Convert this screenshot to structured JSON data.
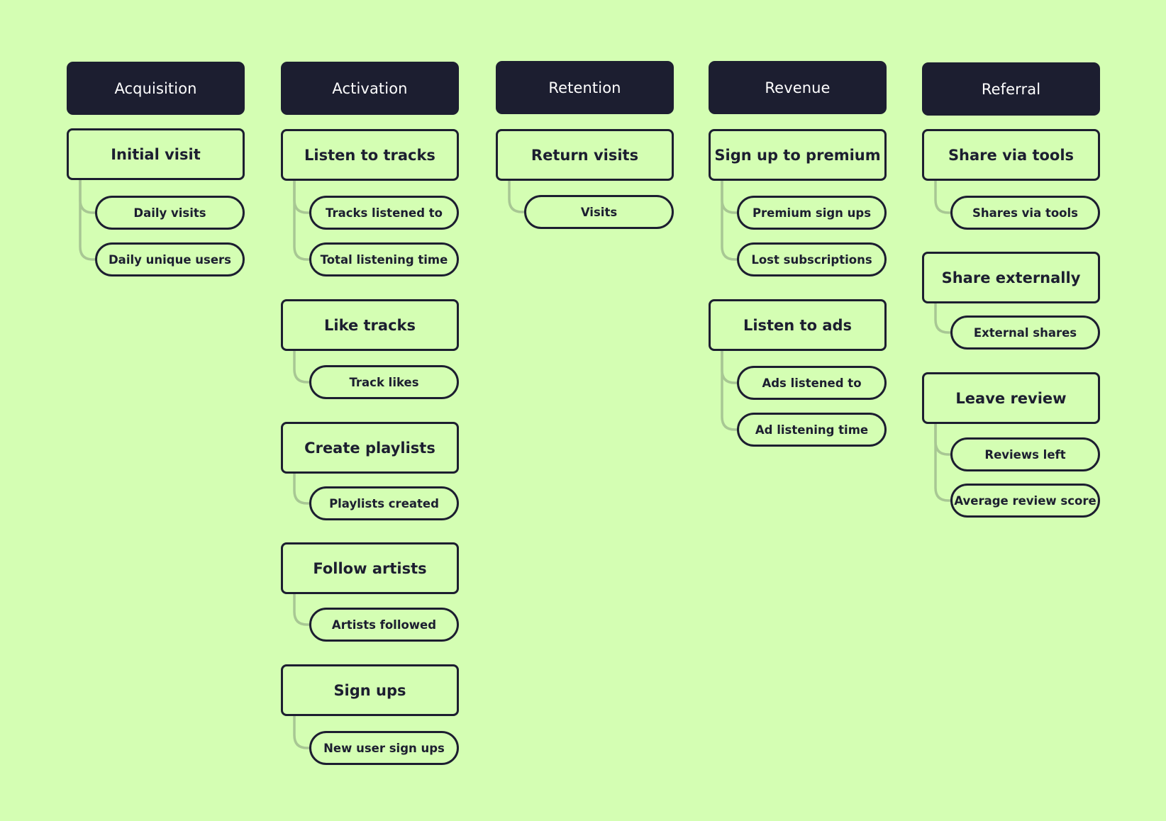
{
  "diagram": {
    "title": "",
    "stages": [
      {
        "name": "Acquisition",
        "groups": [
          {
            "activity": "Initial visit",
            "metrics": [
              "Daily visits",
              "Daily unique users"
            ]
          }
        ]
      },
      {
        "name": "Activation",
        "groups": [
          {
            "activity": "Listen to tracks",
            "metrics": [
              "Tracks listened to",
              "Total listening time"
            ]
          },
          {
            "activity": "Like tracks",
            "metrics": [
              "Track likes"
            ]
          },
          {
            "activity": "Create playlists",
            "metrics": [
              "Playlists created"
            ]
          },
          {
            "activity": "Follow artists",
            "metrics": [
              "Artists followed"
            ]
          },
          {
            "activity": "Sign ups",
            "metrics": [
              "New user sign ups"
            ]
          }
        ]
      },
      {
        "name": "Retention",
        "groups": [
          {
            "activity": "Return visits",
            "metrics": [
              "Visits"
            ]
          }
        ]
      },
      {
        "name": "Revenue",
        "groups": [
          {
            "activity": "Sign up to premium",
            "metrics": [
              "Premium sign ups",
              "Lost subscriptions"
            ]
          },
          {
            "activity": "Listen to ads",
            "metrics": [
              "Ads listened to",
              "Ad listening time"
            ]
          }
        ]
      },
      {
        "name": "Referral",
        "groups": [
          {
            "activity": "Share via tools",
            "metrics": [
              "Shares via tools"
            ]
          },
          {
            "activity": "Share externally",
            "metrics": [
              "External shares"
            ]
          },
          {
            "activity": "Leave review",
            "metrics": [
              "Reviews left",
              "Average review score"
            ]
          }
        ]
      }
    ]
  },
  "colors": {
    "background": "#d4feb3",
    "header_fill": "#1c1e30",
    "header_text": "#ffffff",
    "outline": "#1c1e30",
    "connector": "#a8c794"
  }
}
